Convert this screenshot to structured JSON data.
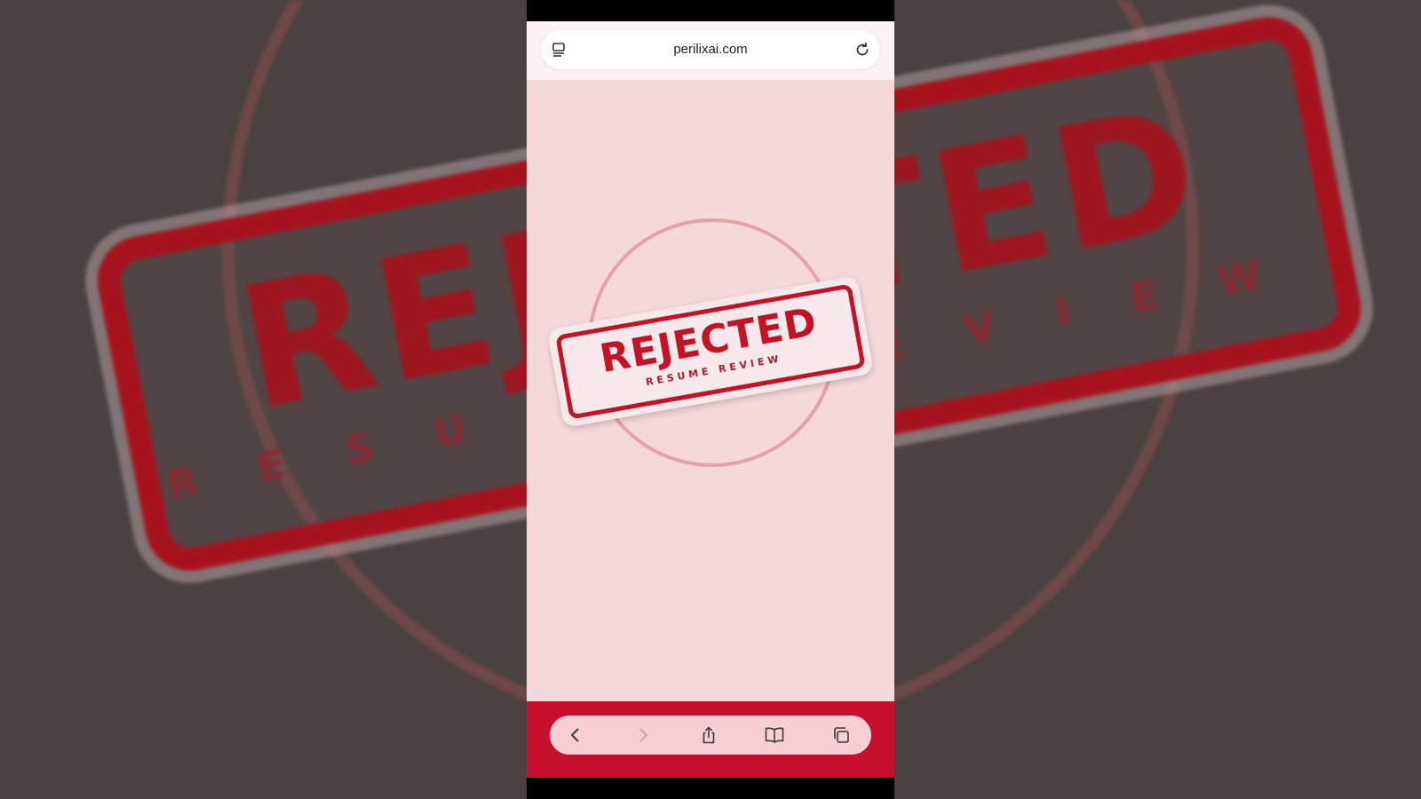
{
  "browser": {
    "url": "perilixai.com"
  },
  "stamp": {
    "word": "REJECTED",
    "subtitle": "RESUME REVIEW"
  },
  "background": {
    "word": "REJECTED",
    "subtitle": "RESUME REVIEW"
  },
  "toolbar": {
    "buttons": [
      "back",
      "forward",
      "share",
      "bookmarks",
      "tabs"
    ]
  },
  "colors": {
    "accent": "#c8102e",
    "page_background": "#f5d8da",
    "stamp_red": "#c41227"
  }
}
